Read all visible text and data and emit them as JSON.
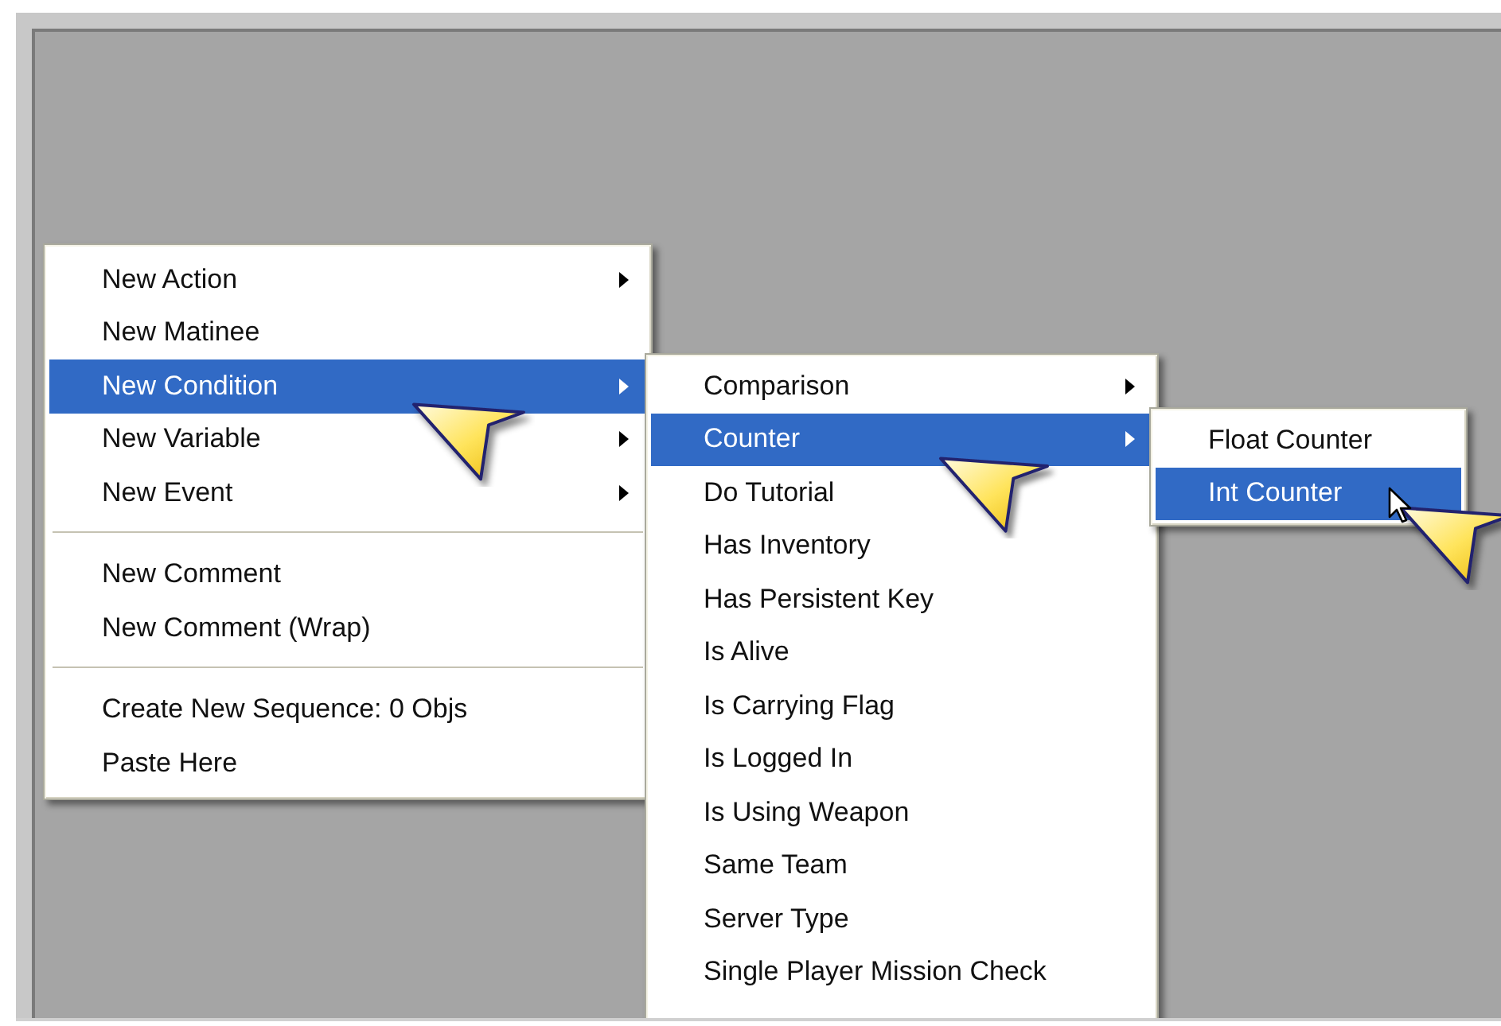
{
  "menus": [
    {
      "items": [
        {
          "kind": "item",
          "label": "New Action",
          "submenu": true,
          "selected": false
        },
        {
          "kind": "item",
          "label": "New Matinee",
          "submenu": false,
          "selected": false
        },
        {
          "kind": "item",
          "label": "New Condition",
          "submenu": true,
          "selected": true
        },
        {
          "kind": "item",
          "label": "New Variable",
          "submenu": true,
          "selected": false
        },
        {
          "kind": "item",
          "label": "New Event",
          "submenu": true,
          "selected": false
        },
        {
          "kind": "separator"
        },
        {
          "kind": "item",
          "label": "New Comment",
          "submenu": false,
          "selected": false
        },
        {
          "kind": "item",
          "label": "New Comment (Wrap)",
          "submenu": false,
          "selected": false
        },
        {
          "kind": "separator"
        },
        {
          "kind": "item",
          "label": "Create New Sequence: 0 Objs",
          "submenu": false,
          "selected": false
        },
        {
          "kind": "item",
          "label": "Paste Here",
          "submenu": false,
          "selected": false
        }
      ]
    },
    {
      "items": [
        {
          "kind": "item",
          "label": "Comparison",
          "submenu": true,
          "selected": false
        },
        {
          "kind": "item",
          "label": "Counter",
          "submenu": true,
          "selected": true
        },
        {
          "kind": "item",
          "label": "Do Tutorial",
          "submenu": false,
          "selected": false
        },
        {
          "kind": "item",
          "label": "Has Inventory",
          "submenu": false,
          "selected": false
        },
        {
          "kind": "item",
          "label": "Has Persistent Key",
          "submenu": false,
          "selected": false
        },
        {
          "kind": "item",
          "label": "Is Alive",
          "submenu": false,
          "selected": false
        },
        {
          "kind": "item",
          "label": "Is Carrying Flag",
          "submenu": false,
          "selected": false
        },
        {
          "kind": "item",
          "label": "Is Logged In",
          "submenu": false,
          "selected": false
        },
        {
          "kind": "item",
          "label": "Is Using Weapon",
          "submenu": false,
          "selected": false
        },
        {
          "kind": "item",
          "label": "Same Team",
          "submenu": false,
          "selected": false
        },
        {
          "kind": "item",
          "label": "Server Type",
          "submenu": false,
          "selected": false
        },
        {
          "kind": "item",
          "label": "Single Player Mission Check",
          "submenu": false,
          "selected": false
        }
      ]
    },
    {
      "items": [
        {
          "kind": "item",
          "label": "Float Counter",
          "submenu": false,
          "selected": false
        },
        {
          "kind": "item",
          "label": "Int Counter",
          "submenu": false,
          "selected": true
        }
      ]
    }
  ]
}
